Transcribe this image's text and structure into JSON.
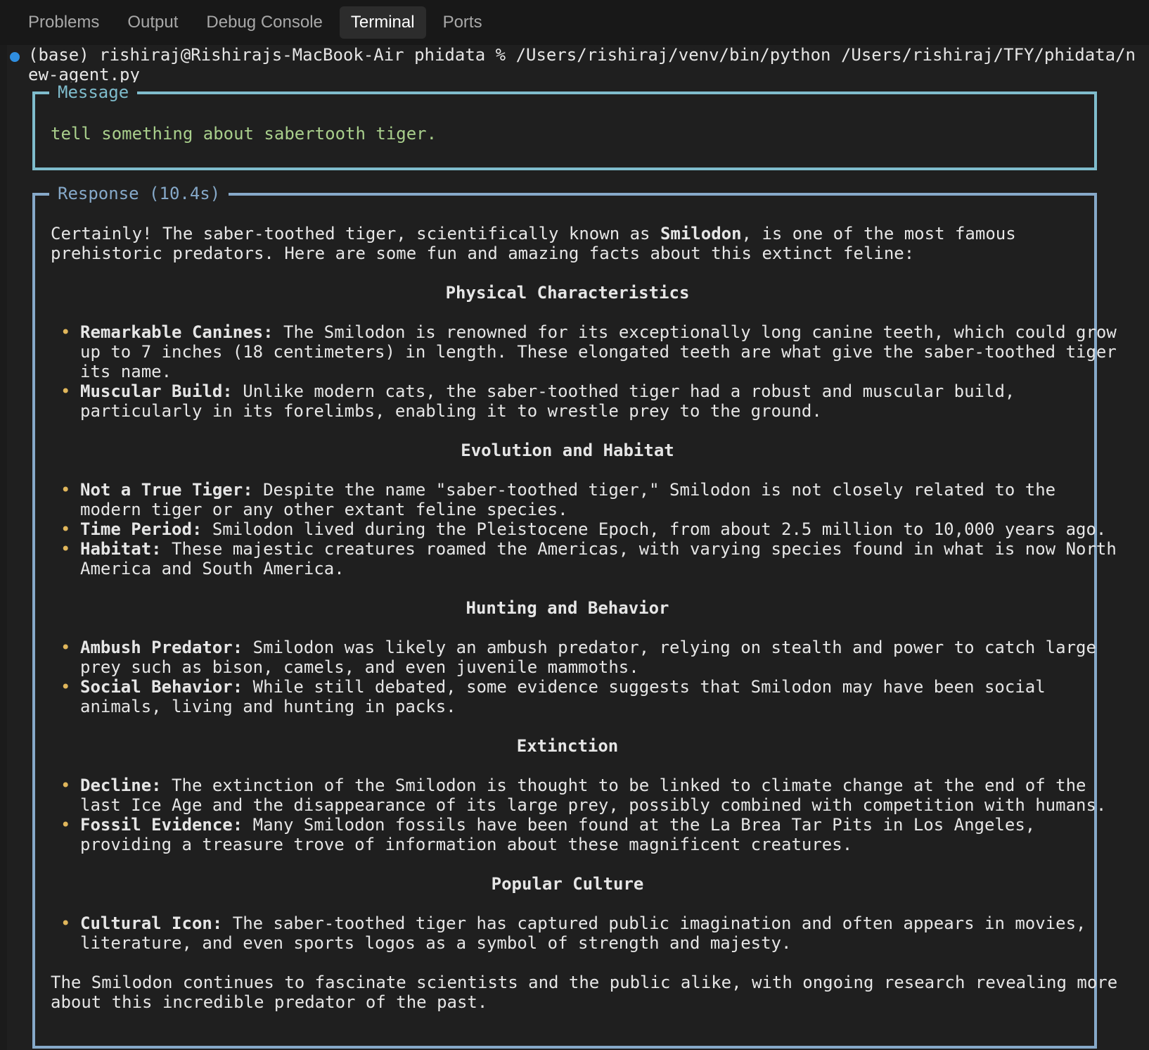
{
  "tabs": [
    {
      "label": "Problems",
      "active": false
    },
    {
      "label": "Output",
      "active": false
    },
    {
      "label": "Debug Console",
      "active": false
    },
    {
      "label": "Terminal",
      "active": true
    },
    {
      "label": "Ports",
      "active": false
    }
  ],
  "terminal": {
    "command_line_1": "(base) rishiraj@Rishirajs-MacBook-Air phidata % /Users/rishiraj/venv/bin/python /Users/rishiraj/TFY/phidata/n",
    "command_line_2": "ew-agent.py",
    "message_title": "Message",
    "message_text": "tell something about sabertooth tiger.",
    "response_title": "Response (10.4s)",
    "intro_1a": "Certainly! The saber-toothed tiger, scientifically known as ",
    "intro_1b": "Smilodon",
    "intro_1c": ", is one of the most famous",
    "intro_2": "prehistoric predators. Here are some fun and amazing facts about this extinct feline:",
    "sections": [
      {
        "heading": "Physical Characteristics",
        "items": [
          {
            "term": "Remarkable Canines:",
            "lines": [
              " The Smilodon is renowned for its exceptionally long canine teeth, which could grow",
              "up to 7 inches (18 centimeters) in length. These elongated teeth are what give the saber-toothed tiger",
              "its name."
            ]
          },
          {
            "term": "Muscular Build:",
            "lines": [
              " Unlike modern cats, the saber-toothed tiger had a robust and muscular build,",
              "particularly in its forelimbs, enabling it to wrestle prey to the ground."
            ]
          }
        ]
      },
      {
        "heading": "Evolution and Habitat",
        "items": [
          {
            "term": "Not a True Tiger:",
            "lines": [
              " Despite the name \"saber-toothed tiger,\" Smilodon is not closely related to the",
              "modern tiger or any other extant feline species."
            ]
          },
          {
            "term": "Time Period:",
            "lines": [
              " Smilodon lived during the Pleistocene Epoch, from about 2.5 million to 10,000 years ago."
            ]
          },
          {
            "term": "Habitat:",
            "lines": [
              " These majestic creatures roamed the Americas, with varying species found in what is now North",
              "America and South America."
            ]
          }
        ]
      },
      {
        "heading": "Hunting and Behavior",
        "items": [
          {
            "term": "Ambush Predator:",
            "lines": [
              " Smilodon was likely an ambush predator, relying on stealth and power to catch large",
              "prey such as bison, camels, and even juvenile mammoths."
            ]
          },
          {
            "term": "Social Behavior:",
            "lines": [
              " While still debated, some evidence suggests that Smilodon may have been social",
              "animals, living and hunting in packs."
            ]
          }
        ]
      },
      {
        "heading": "Extinction",
        "items": [
          {
            "term": "Decline:",
            "lines": [
              " The extinction of the Smilodon is thought to be linked to climate change at the end of the",
              "last Ice Age and the disappearance of its large prey, possibly combined with competition with humans."
            ]
          },
          {
            "term": "Fossil Evidence:",
            "lines": [
              " Many Smilodon fossils have been found at the La Brea Tar Pits in Los Angeles,",
              "providing a treasure trove of information about these magnificent creatures."
            ]
          }
        ]
      },
      {
        "heading": "Popular Culture",
        "items": [
          {
            "term": "Cultural Icon:",
            "lines": [
              " The saber-toothed tiger has captured public imagination and often appears in movies,",
              "literature, and even sports logos as a symbol of strength and majesty."
            ]
          }
        ]
      }
    ],
    "outro_1": "The Smilodon continues to fascinate scientists and the public alike, with ongoing research revealing more",
    "outro_2": "about this incredible predator of the past."
  },
  "colors": {
    "message_border": "#7fbccc",
    "response_border": "#86a9c9",
    "message_text": "#a9cf8c",
    "bullet": "#e0b65b",
    "status_dot": "#2f8ee0"
  }
}
